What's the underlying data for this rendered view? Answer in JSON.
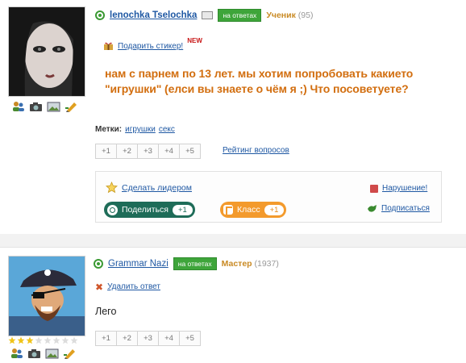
{
  "question_post": {
    "user": {
      "name": "lenochka Tselochka",
      "badge": "на ответах",
      "rank": "Ученик",
      "rank_score": "(95)"
    },
    "sticker": {
      "label": "Подарить стикер!",
      "new_badge": "NEW"
    },
    "question_text": "нам с парнем по 13 лет. мы хотим попробовать какието \"игрушки\" (елси вы знаете о чём я ;) Что посоветуете?",
    "tags": {
      "label": "Метки:",
      "items": [
        "игрушки",
        "секс"
      ]
    },
    "votes": [
      "+1",
      "+2",
      "+3",
      "+4",
      "+5"
    ],
    "rating_link": "Рейтинг вопросов",
    "actions": {
      "leader": "Сделать лидером",
      "violation": "Нарушение!",
      "share_label": "Поделиться",
      "share_count": "+1",
      "class_label": "Класс",
      "class_count": "+1",
      "subscribe": "Подписаться"
    }
  },
  "answer_post": {
    "user": {
      "name": "Grammar Nazi",
      "badge": "на ответах",
      "rank": "Мастер",
      "rank_score": "(1937)"
    },
    "delete_label": "Удалить ответ",
    "answer_text": "Лего",
    "votes": [
      "+1",
      "+2",
      "+3",
      "+4",
      "+5"
    ]
  },
  "colors": {
    "link_blue": "#1f58a3",
    "question_orange": "#d26e0f",
    "badge_green": "#3ea53a",
    "share_teal": "#1e6c58",
    "class_orange": "#f39a2c",
    "rank_gold": "#c98a24"
  },
  "icons": [
    "user-group-icon",
    "camera-icon",
    "photo-icon",
    "pencil-icon",
    "mail-icon",
    "gift-icon",
    "star-icon",
    "violation-icon",
    "subscribe-icon",
    "delete-x-icon"
  ]
}
